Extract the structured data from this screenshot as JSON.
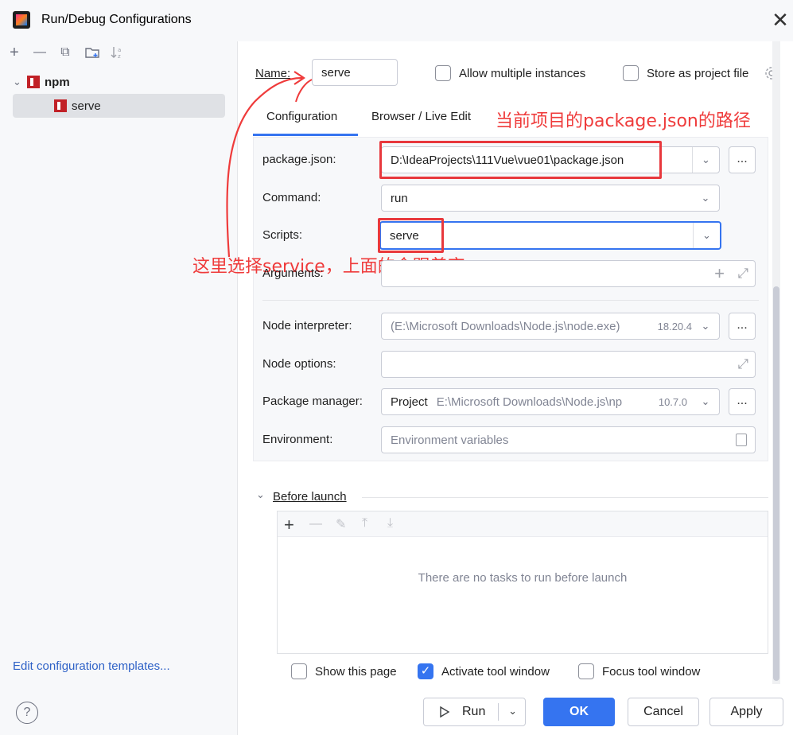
{
  "window": {
    "title": "Run/Debug Configurations",
    "close_glyph": "✕"
  },
  "sidebar": {
    "toolbar": [
      {
        "name": "add-icon",
        "glyph": "+"
      },
      {
        "name": "remove-icon",
        "glyph": "—"
      },
      {
        "name": "copy-icon",
        "glyph": "⧉"
      },
      {
        "name": "new-folder-icon",
        "glyph": "🗀"
      },
      {
        "name": "sort-icon",
        "glyph": "↓ᵃᶻ"
      }
    ],
    "tree": {
      "group": "npm",
      "item": "serve"
    },
    "edit_templates": "Edit configuration templates..."
  },
  "header": {
    "name_label": "Name:",
    "name_value": "serve",
    "allow_multiple": "Allow multiple instances",
    "store_as_file": "Store as project file"
  },
  "tabs": [
    {
      "label": "Configuration",
      "active": true
    },
    {
      "label": "Browser / Live Edit",
      "active": false
    }
  ],
  "form": {
    "package_json_label": "package.json:",
    "package_json_value": "D:\\IdeaProjects\\111Vue\\vue01\\package.json",
    "command_label": "Command:",
    "command_value": "run",
    "scripts_label": "Scripts:",
    "scripts_value": "serve",
    "arguments_label": "Arguments:",
    "node_interpreter_label": "Node interpreter:",
    "node_interpreter_value": "(E:\\Microsoft Downloads\\Node.js\\node.exe)",
    "node_version": "18.20.4",
    "node_options_label": "Node options:",
    "package_manager_label": "Package manager:",
    "package_manager_name": "Project",
    "package_manager_path": "E:\\Microsoft Downloads\\Node.js\\np",
    "package_manager_version": "10.7.0",
    "environment_label": "Environment:",
    "environment_placeholder": "Environment variables",
    "browse": "..."
  },
  "before_launch": {
    "title": "Before launch",
    "empty_text": "There are no tasks to run before launch"
  },
  "bottom_options": {
    "show_page": "Show this page",
    "activate_tool": "Activate tool window",
    "focus_tool": "Focus tool window"
  },
  "buttons": {
    "run": "Run",
    "ok": "OK",
    "cancel": "Cancel",
    "apply": "Apply"
  },
  "annotations": {
    "package_path_note": "当前项目的package.json的路径",
    "scripts_note": "这里选择service，上面的会跟着变"
  },
  "colors": {
    "accent": "#3574f0",
    "annotation": "#ef3b3b",
    "npm": "#c12127"
  }
}
